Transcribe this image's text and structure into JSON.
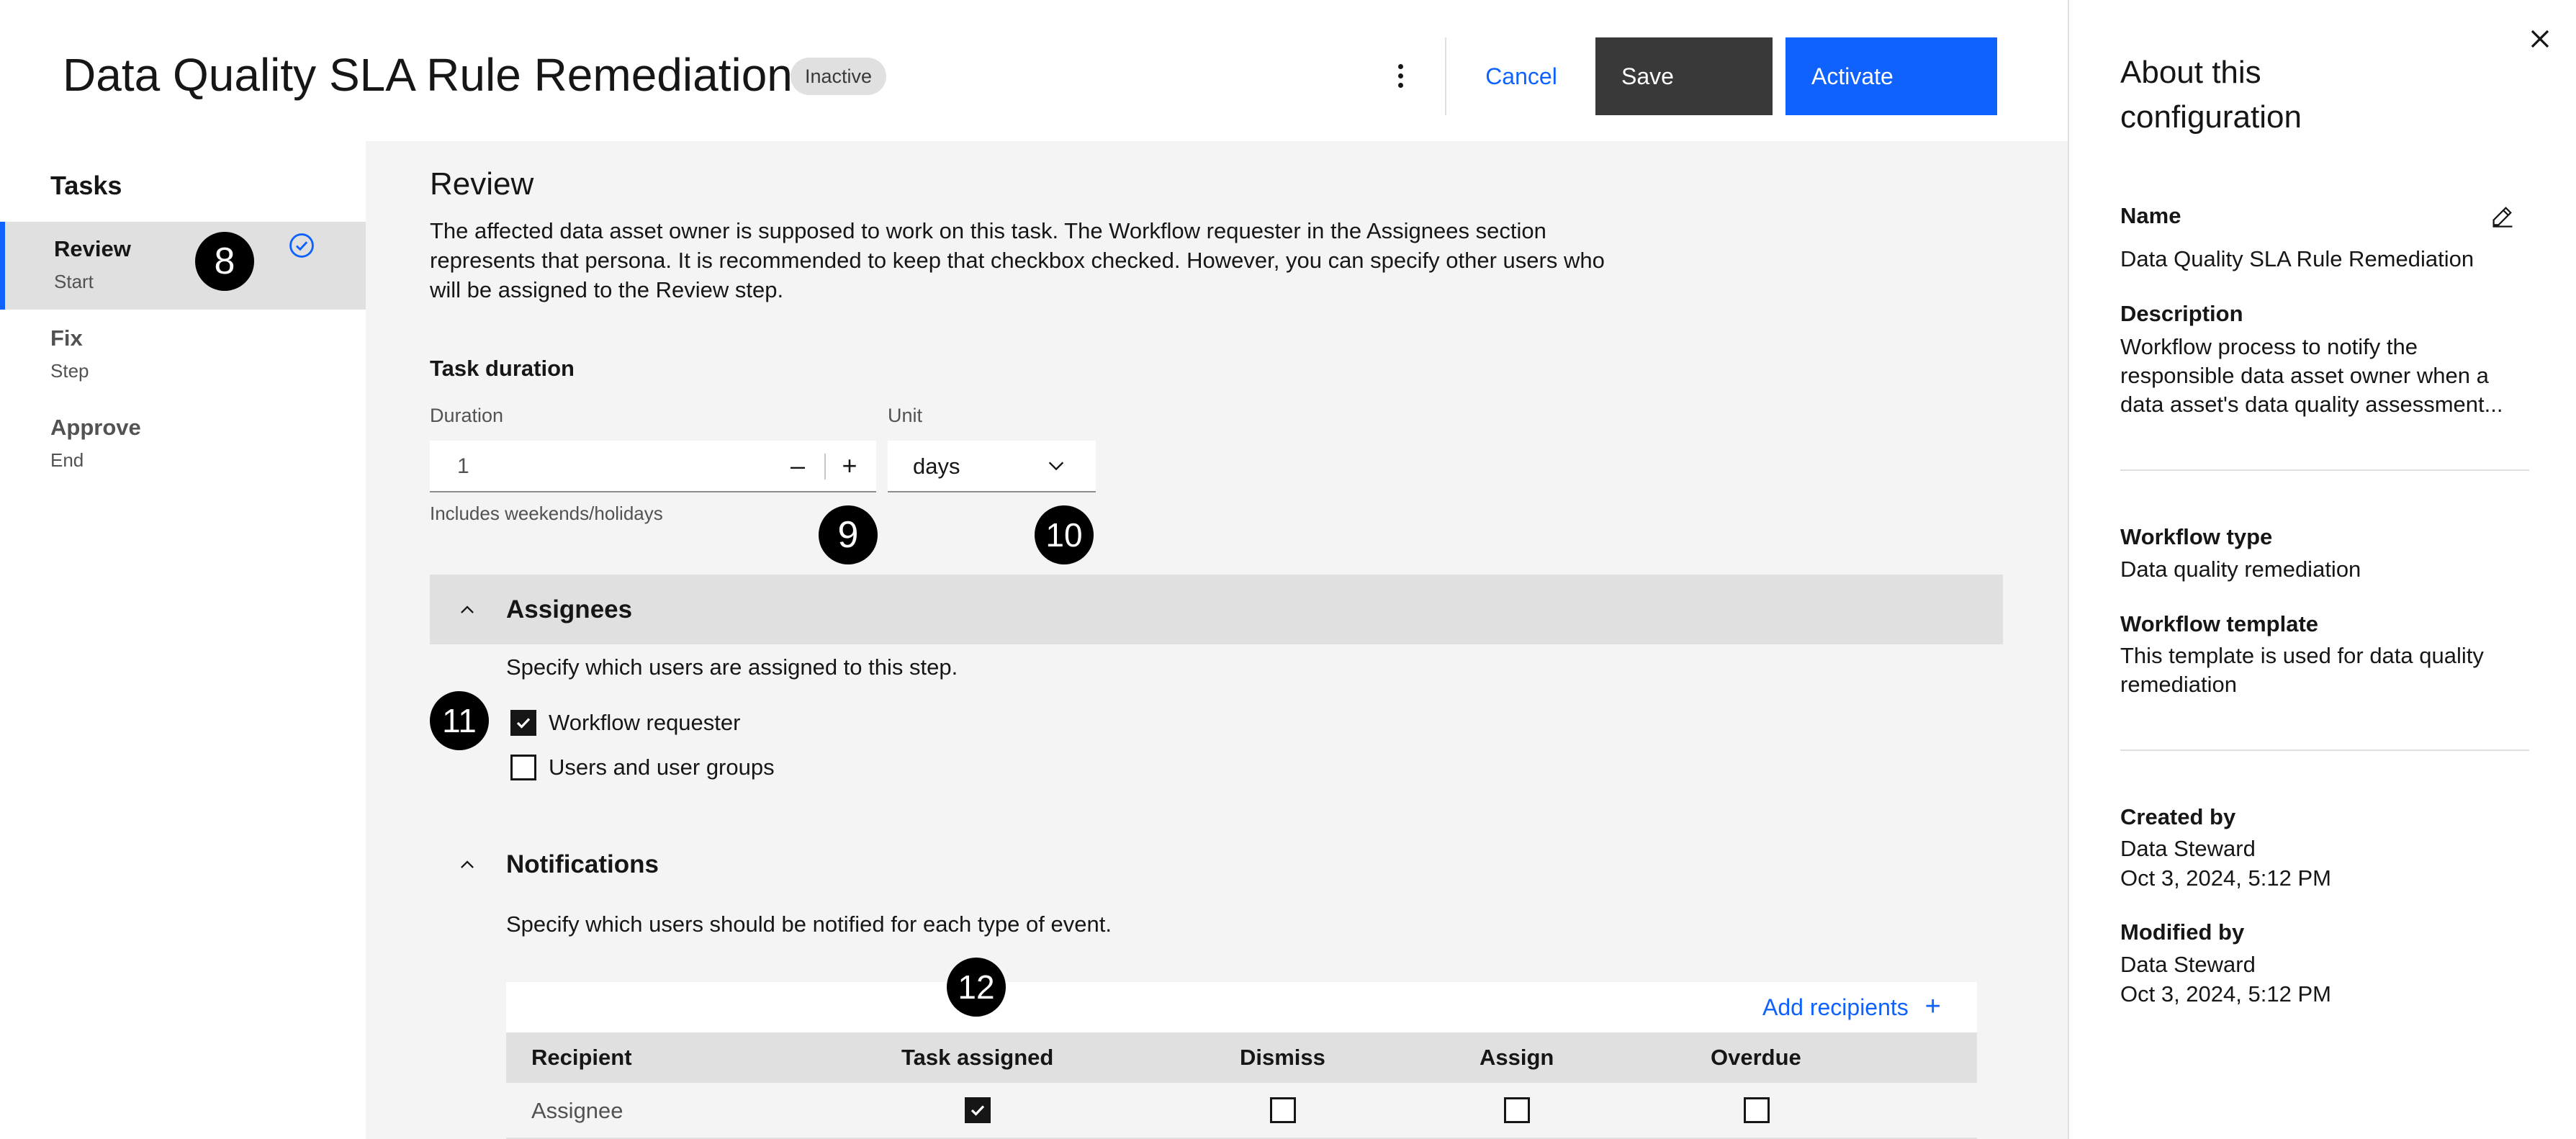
{
  "header": {
    "title": "Data Quality SLA Rule Remediation",
    "status": "Inactive",
    "cancel_label": "Cancel",
    "save_label": "Save",
    "activate_label": "Activate"
  },
  "tasks": {
    "title": "Tasks",
    "items": [
      {
        "name": "Review",
        "kind": "Start",
        "selected": true,
        "completed": true
      },
      {
        "name": "Fix",
        "kind": "Step",
        "selected": false
      },
      {
        "name": "Approve",
        "kind": "End",
        "selected": false
      }
    ]
  },
  "main": {
    "heading": "Review",
    "description": "The affected data asset owner is supposed to work on this task. The Workflow requester in the Assignees section represents that persona. It is recommended to keep that checkbox checked. However, you can specify other users who will be assigned to the Review step.",
    "duration": {
      "heading": "Task duration",
      "label": "Duration",
      "value": "1",
      "minus": "–",
      "plus": "+",
      "unit_label": "Unit",
      "unit_value": "days",
      "helper": "Includes weekends/holidays"
    },
    "assignees": {
      "title": "Assignees",
      "description": "Specify which users are assigned to this step.",
      "options": [
        {
          "label": "Workflow requester",
          "checked": true
        },
        {
          "label": "Users and user groups",
          "checked": false
        }
      ]
    },
    "notifications": {
      "title": "Notifications",
      "description": "Specify which users should be notified for each type of event.",
      "add_recipients": "Add recipients",
      "columns": [
        "Recipient",
        "Task assigned",
        "Dismiss",
        "Assign",
        "Overdue"
      ],
      "rows": [
        {
          "recipient": "Assignee",
          "task_assigned": true,
          "dismiss": false,
          "assign": false,
          "overdue": false
        }
      ]
    }
  },
  "markers": [
    "8",
    "9",
    "10",
    "11",
    "12"
  ],
  "about": {
    "title": "About this configuration",
    "name_label": "Name",
    "name_value": "Data Quality SLA Rule Remediation",
    "description_label": "Description",
    "description_value": "Workflow process to notify the responsible data asset owner when a data asset's data quality assessment...",
    "type_label": "Workflow type",
    "type_value": "Data quality remediation",
    "template_label": "Workflow template",
    "template_value": "This template is used for data quality remediation",
    "created_label": "Created by",
    "created_by": "Data Steward",
    "created_at": "Oct 3, 2024, 5:12 PM",
    "modified_label": "Modified by",
    "modified_by": "Data Steward",
    "modified_at": "Oct 3, 2024, 5:12 PM"
  },
  "colors": {
    "primary": "#0f62fe",
    "secondary_button": "#393939",
    "background": "#f4f4f4",
    "marker": "#000000"
  },
  "icons": [
    "overflow-menu-icon",
    "checkmark-outline-icon",
    "chevron-down-icon",
    "chevron-up-icon",
    "add-icon",
    "edit-icon",
    "close-icon",
    "checkmark-icon"
  ]
}
